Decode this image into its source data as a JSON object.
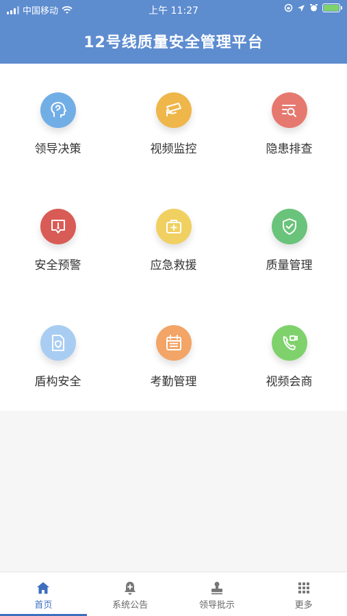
{
  "status_bar": {
    "carrier": "中国移动",
    "time": "上午 11:27"
  },
  "header": {
    "title": "12号线质量安全管理平台"
  },
  "tiles": [
    {
      "label": "领导决策",
      "icon": "head-brain-icon",
      "color": "#72aee6"
    },
    {
      "label": "视频监控",
      "icon": "cctv-camera-icon",
      "color": "#efb64a"
    },
    {
      "label": "隐患排查",
      "icon": "search-list-icon",
      "color": "#e6796f"
    },
    {
      "label": "安全预警",
      "icon": "warning-message-icon",
      "color": "#d95b55"
    },
    {
      "label": "应急救援",
      "icon": "first-aid-kit-icon",
      "color": "#f1d062"
    },
    {
      "label": "质量管理",
      "icon": "shield-check-icon",
      "color": "#6ac37a"
    },
    {
      "label": "盾构安全",
      "icon": "document-shield-icon",
      "color": "#a9cdf2"
    },
    {
      "label": "考勤管理",
      "icon": "calendar-icon",
      "color": "#f2a566"
    },
    {
      "label": "视频会商",
      "icon": "video-phone-icon",
      "color": "#7fd26b"
    }
  ],
  "tabs": [
    {
      "label": "首页",
      "icon": "home-icon",
      "active": true
    },
    {
      "label": "系统公告",
      "icon": "notice-bell-icon",
      "active": false
    },
    {
      "label": "领导批示",
      "icon": "stamp-icon",
      "active": false
    },
    {
      "label": "更多",
      "icon": "grid-dots-icon",
      "active": false
    }
  ],
  "colors": {
    "header": "#5d8ccf",
    "accent": "#3d6fbf",
    "background": "#f6f6f7"
  }
}
